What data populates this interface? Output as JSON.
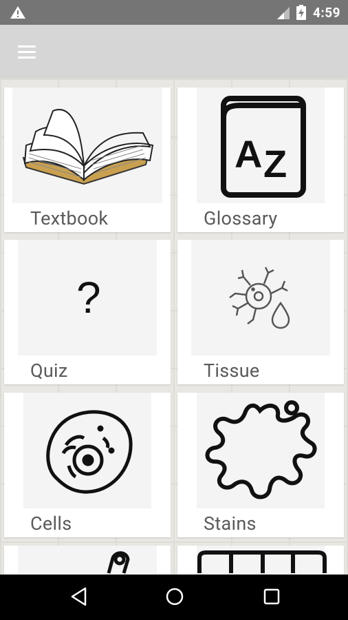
{
  "status_bar": {
    "time": "4:59"
  },
  "app_bar": {
    "menu_icon": "hamburger-menu-icon"
  },
  "tiles": [
    {
      "label": "Textbook",
      "icon": "open-book-icon"
    },
    {
      "label": "Glossary",
      "icon": "az-dictionary-icon"
    },
    {
      "label": "Quiz",
      "icon": "question-mark-icon"
    },
    {
      "label": "Tissue",
      "icon": "neuron-droplet-icon"
    },
    {
      "label": "Cells",
      "icon": "cell-icon"
    },
    {
      "label": "Stains",
      "icon": "splat-stain-icon"
    }
  ],
  "partial_tiles": [
    {
      "icon": "microscope-partial-icon"
    },
    {
      "icon": "grid-partial-icon"
    }
  ],
  "nav_bar": {
    "back_icon": "back-icon",
    "home_icon": "home-icon",
    "recents_icon": "recents-icon"
  }
}
